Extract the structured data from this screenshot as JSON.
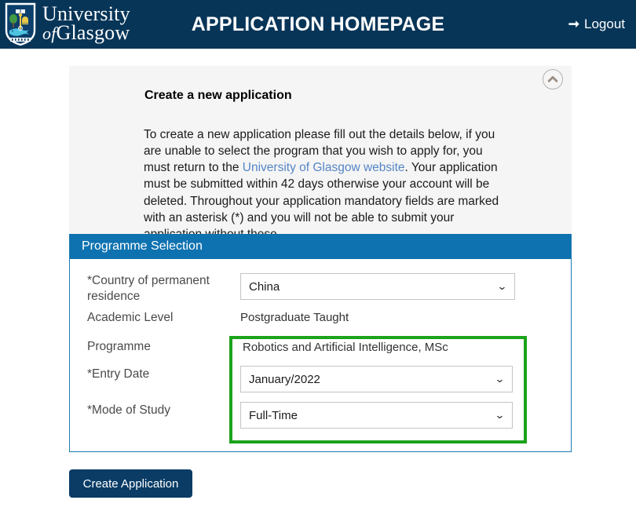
{
  "header": {
    "title": "APPLICATION HOMEPAGE",
    "brand": {
      "line1": "University",
      "of": "of",
      "line2": "Glasgow",
      "crest_icon": "glasgow-university-crest"
    },
    "logout": {
      "label": "Logout",
      "icon": "arrow-right-icon"
    },
    "background_color": "#073558"
  },
  "intro": {
    "collapse_icon": "chevron-up-circle-icon",
    "heading": "Create a new application",
    "paragraph_part1": "To create a new application please fill out the details below, if you are unable to select the program that you wish to apply for, you must return to the ",
    "link_text": "University of Glasgow website",
    "paragraph_part2": ". Your application must be submitted within 42 days otherwise your account will be deleted.  Throughout your application mandatory fields are marked with an asterisk (*) and you will not be able  to submit your application without these.",
    "link_color": "#5585c6",
    "background_color": "#f5f5f5"
  },
  "form": {
    "section_title": "Programme Selection",
    "section_color": "#0f72b0",
    "highlight_color": "#1ba31b",
    "fields": {
      "country": {
        "label": "*Country of permanent residence",
        "value": "China",
        "caret_icon": "chevron-down-icon"
      },
      "academic_level": {
        "label": "Academic Level",
        "value": "Postgraduate Taught"
      },
      "programme": {
        "label": "Programme",
        "value": "Robotics and Artificial Intelligence, MSc"
      },
      "entry_date": {
        "label": "*Entry Date",
        "value": "January/2022",
        "caret_icon": "chevron-down-icon"
      },
      "mode_of_study": {
        "label": "*Mode of Study",
        "value": "Full-Time",
        "caret_icon": "chevron-down-icon"
      }
    }
  },
  "actions": {
    "create_application_label": "Create Application",
    "button_color": "#0a3c66"
  }
}
